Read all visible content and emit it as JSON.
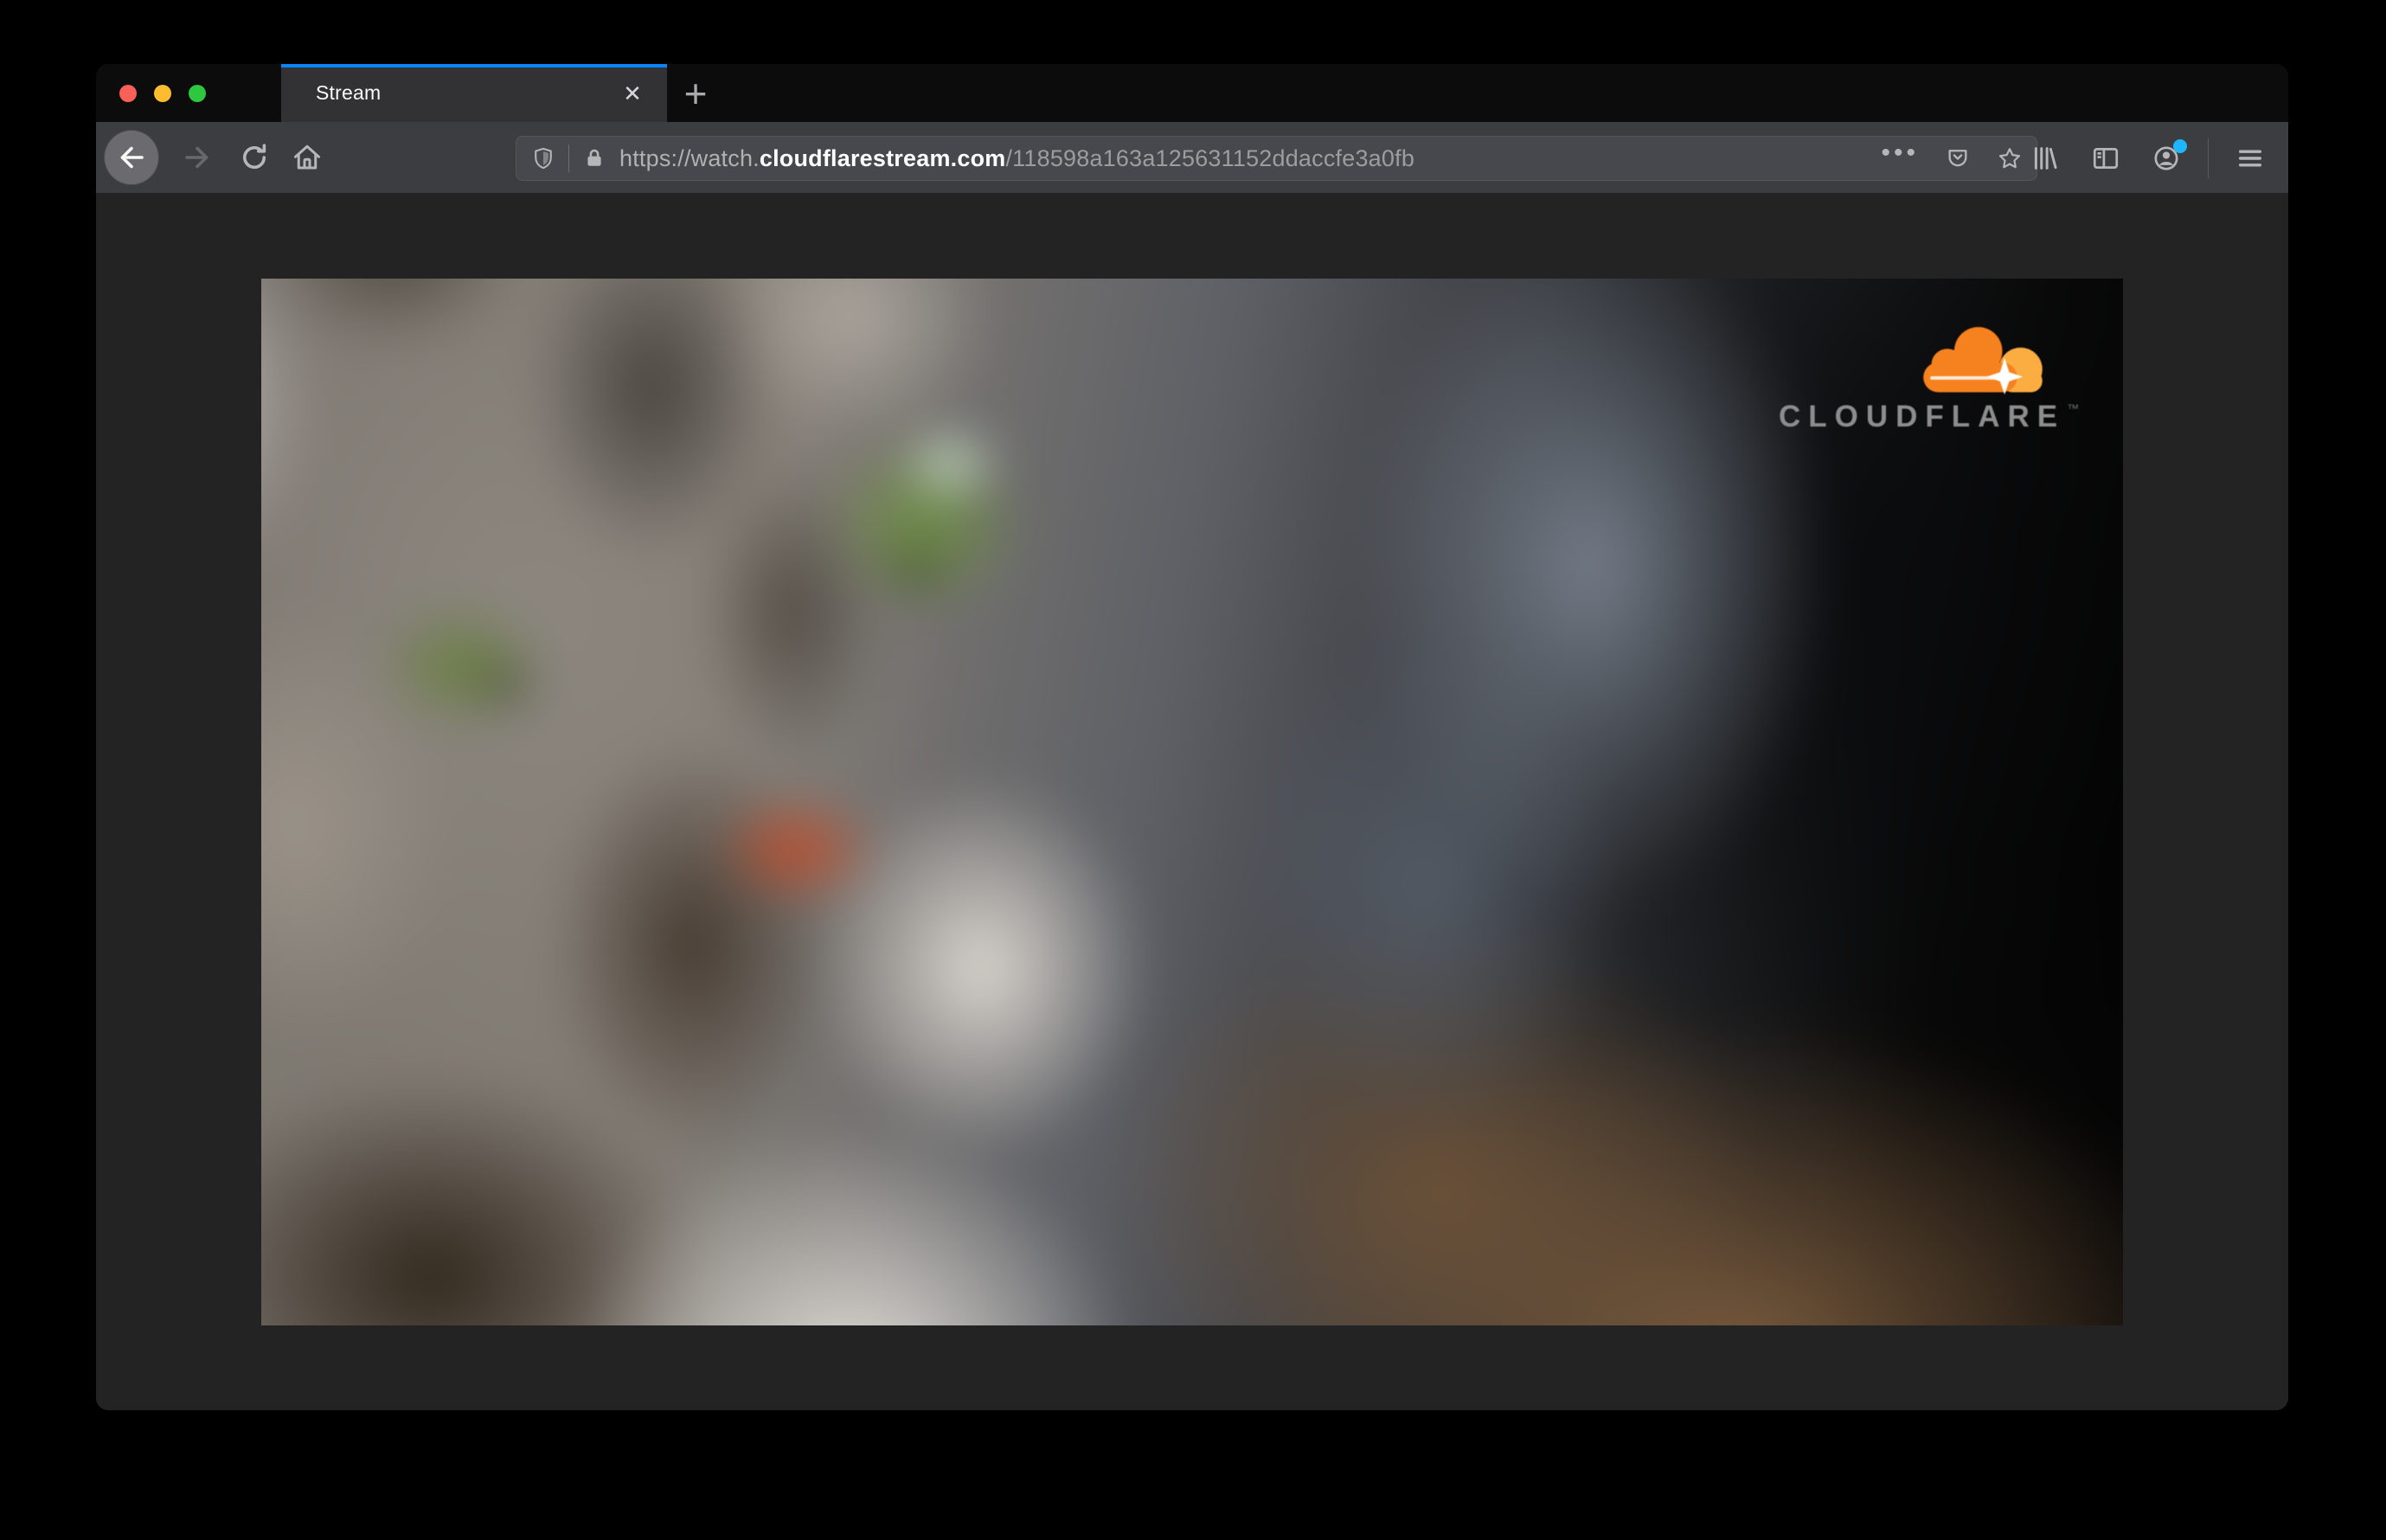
{
  "tab_bar": {
    "tab": {
      "title": "Stream"
    },
    "close_glyph": "✕",
    "new_tab_glyph": "+"
  },
  "toolbar": {
    "url": {
      "prefix": "https://watch.",
      "domain": "cloudflarestream.com",
      "path": "/118598a163a125631152ddaccfe3a0fb"
    },
    "page_actions_glyph": "•••"
  },
  "video": {
    "brand": {
      "name": "CLOUDFLARE",
      "mark": "™"
    }
  },
  "colors": {
    "accent_blue": "#0a84ff",
    "badge_blue": "#1fb6ff",
    "traffic_red": "#f96057",
    "traffic_yellow": "#fcbc2f",
    "traffic_green": "#2fc640",
    "cloud_orange": "#f6821f",
    "cloud_light_orange": "#fbad41"
  }
}
